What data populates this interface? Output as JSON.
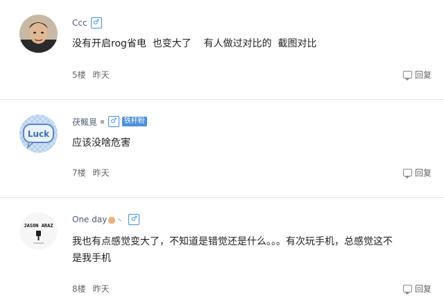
{
  "comments": [
    {
      "username": "Ccc",
      "gender_symbol": "♂",
      "text": "没有开启rog省电  也变大了    有人做过对比的  截图对比",
      "floor": "5楼",
      "time": "昨天",
      "reply_label": "回复"
    },
    {
      "username": "茯鲺覓",
      "gender_symbol": "♂",
      "badge": "铁杆粉",
      "text": "应该没啥危害",
      "floor": "7楼",
      "time": "昨天",
      "reply_label": "回复",
      "avatar_text": "Luck"
    },
    {
      "username": "One day",
      "tick": "丶",
      "gender_symbol": "♂",
      "text_line1": "我也有点感觉变大了，不知道是错觉还是什么。。。有次玩手机，总感觉这不",
      "text_line2": "是我手机",
      "floor": "8楼",
      "time": "昨天",
      "reply_label": "回复",
      "avatar_text": "JASON ARAZ"
    }
  ],
  "colors": {
    "username": "#4b5a76",
    "gender": "#3a8ee6",
    "badge_bg": "#4d8fe0",
    "divider": "#e6e6e6"
  }
}
